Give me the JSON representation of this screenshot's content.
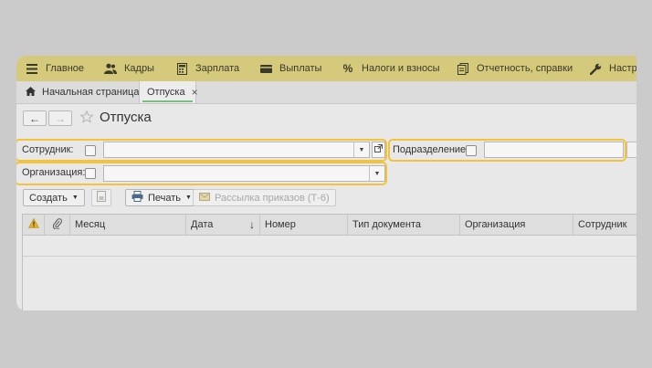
{
  "top_menu": {
    "items": [
      {
        "label": "Главное",
        "icon": "menu-icon"
      },
      {
        "label": "Кадры",
        "icon": "people-icon"
      },
      {
        "label": "Зарплата",
        "icon": "calculator-icon"
      },
      {
        "label": "Выплаты",
        "icon": "wallet-icon"
      },
      {
        "label": "Налоги и взносы",
        "icon": "percent-icon"
      },
      {
        "label": "Отчетность, справки",
        "icon": "reports-icon"
      },
      {
        "label": "Настр",
        "icon": "wrench-icon"
      }
    ]
  },
  "tabs": {
    "home": "Начальная страница",
    "active": "Отпуска",
    "close_symbol": "×"
  },
  "page": {
    "title": "Отпуска",
    "nav_back": "←",
    "nav_forward": "→"
  },
  "filters": {
    "employee_label": "Сотрудник:",
    "employee_value": "",
    "department_label": "Подразделение:",
    "department_value": "",
    "organization_label": "Организация:",
    "organization_value": ""
  },
  "toolbar": {
    "create": "Создать",
    "print": "Печать",
    "mailing": "Рассылка приказов (Т-6)"
  },
  "table": {
    "columns": [
      "Месяц",
      "Дата",
      "Номер",
      "Тип документа",
      "Организация",
      "Сотрудник"
    ],
    "sort_indicator": "↓",
    "rows": []
  },
  "colors": {
    "menu_bar": "#d5c97c",
    "highlight": "#f3c33a",
    "active_tab_underline": "#7bbd7e"
  }
}
